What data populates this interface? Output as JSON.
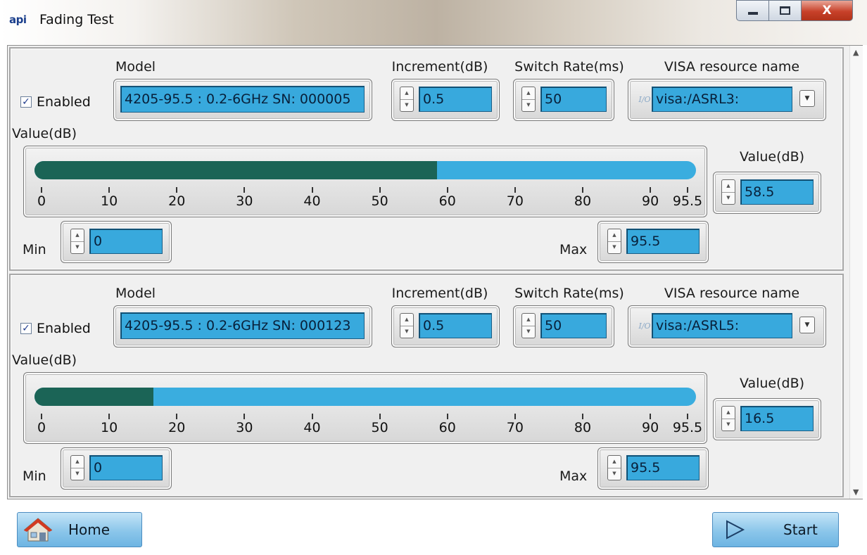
{
  "window": {
    "logo": "api",
    "title": "Fading Test",
    "close_glyph": "X"
  },
  "scale": {
    "min": 0,
    "max": 95.5,
    "tick_labels": [
      "0",
      "10",
      "20",
      "30",
      "40",
      "50",
      "60",
      "70",
      "80",
      "90",
      "95.5"
    ]
  },
  "channels": [
    {
      "enabled_label": "Enabled",
      "enabled": true,
      "model_label": "Model",
      "model": "4205-95.5 : 0.2-6GHz SN: 000005",
      "increment_label": "Increment(dB)",
      "increment": "0.5",
      "switch_rate_label": "Switch Rate(ms)",
      "switch_rate": "50",
      "visa_label": "VISA resource name",
      "visa": "visa:/ASRL3:",
      "slider_label": "Value(dB)",
      "value_label": "Value(dB)",
      "value": "58.5",
      "min_label": "Min",
      "min": "0",
      "max_label": "Max",
      "max": "95.5"
    },
    {
      "enabled_label": "Enabled",
      "enabled": true,
      "model_label": "Model",
      "model": "4205-95.5 : 0.2-6GHz SN: 000123",
      "increment_label": "Increment(dB)",
      "increment": "0.5",
      "switch_rate_label": "Switch Rate(ms)",
      "switch_rate": "50",
      "visa_label": "VISA resource name",
      "visa": "visa:/ASRL5:",
      "slider_label": "Value(dB)",
      "value_label": "Value(dB)",
      "value": "16.5",
      "min_label": "Min",
      "min": "0",
      "max_label": "Max",
      "max": "95.5"
    }
  ],
  "buttons": {
    "home": "Home",
    "start": "Start"
  },
  "icons": {
    "home": "house-icon",
    "start": "play-arrow-icon",
    "spin": "up-down-spinner-icon",
    "visa": "io-icon",
    "dropdown": "dropdown-arrow-icon"
  },
  "colors": {
    "field": "#38a9dd",
    "slider_fill": "#1b6456",
    "slider_track": "#3aaddf",
    "button": "#8bc6ea"
  }
}
